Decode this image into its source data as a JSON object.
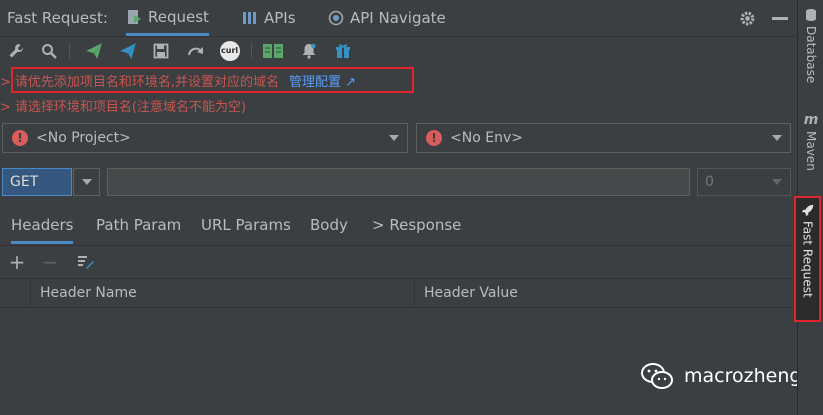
{
  "header": {
    "app_title": "Fast Request:",
    "tabs": [
      {
        "label": "Request",
        "icon": "request-icon",
        "active": true
      },
      {
        "label": "APIs",
        "icon": "bars-icon",
        "active": false
      },
      {
        "label": "API Navigate",
        "icon": "navigate-icon",
        "active": false
      }
    ]
  },
  "toolbar": {
    "icons": [
      "wrench-icon",
      "search-icon",
      "send-green-icon",
      "send-blue-icon",
      "save-icon",
      "redo-icon",
      "curl-icon",
      "book-icon",
      "bell-icon",
      "gift-icon"
    ],
    "curl_label": "curl"
  },
  "messages": {
    "line1": "请优先添加项目名和环境名,并设置对应的域名",
    "link": "管理配置 ↗",
    "line2": "请选择环境和项目名(注意域名不能为空)",
    "arrow": ">"
  },
  "selects": {
    "project": "<No Project>",
    "env": "<No Env>",
    "error_mark": "!"
  },
  "request": {
    "method": "GET",
    "url": "",
    "number": "0"
  },
  "param_tabs": [
    "Headers",
    "Path Param",
    "URL Params",
    "Body",
    "> Response"
  ],
  "table": {
    "add": "+",
    "remove": "−",
    "columns": [
      "Header Name",
      "Header Value"
    ]
  },
  "watermark": "macrozheng",
  "rail": [
    "Database",
    "Maven",
    "Fast Request"
  ],
  "colors": {
    "accent": "#4a88c7",
    "error": "#c75450",
    "link": "#589df6",
    "highlight_box": "#e0252f"
  }
}
